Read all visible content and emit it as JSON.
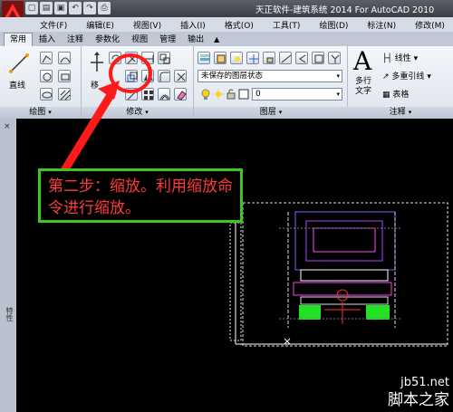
{
  "window": {
    "title": "天正软件-建筑系统 2014  For AutoCAD 2010"
  },
  "quick_access": [
    "new-icon",
    "open-icon",
    "save-icon",
    "undo-icon",
    "redo-icon",
    "print-icon"
  ],
  "menu": [
    "文件(F)",
    "编辑(E)",
    "视图(V)",
    "插入(I)",
    "格式(O)",
    "工具(T)",
    "绘图(D)",
    "标注(N)",
    "修改(M)"
  ],
  "ribbon_tabs": [
    "常用",
    "插入",
    "注释",
    "参数化",
    "视图",
    "管理",
    "输出"
  ],
  "ribbon_tabs_toggle": "▲",
  "panels": {
    "draw": {
      "title": "绘图",
      "line_label": "直线"
    },
    "modify": {
      "title": "修改",
      "move_label": "移"
    },
    "layers": {
      "title": "图层",
      "state_value": "未保存的图层状态",
      "current_layer": "0"
    },
    "annotation": {
      "title": "注释",
      "multiline_text_label": "多行\n文字",
      "text_big_glyph": "A",
      "linear_label": "线性",
      "multileader_label": "多重引线",
      "table_label": "表格"
    }
  },
  "dropdown_glyph": "▾",
  "side_palette": {
    "close": "×",
    "label": "特性"
  },
  "callout": {
    "text": "第二步：缩放。利用缩放命令进行缩放。",
    "border_color": "#3ec81e",
    "text_color": "#ff3b3b"
  },
  "watermark": {
    "url": "jb51.net",
    "name": "脚本之家"
  }
}
